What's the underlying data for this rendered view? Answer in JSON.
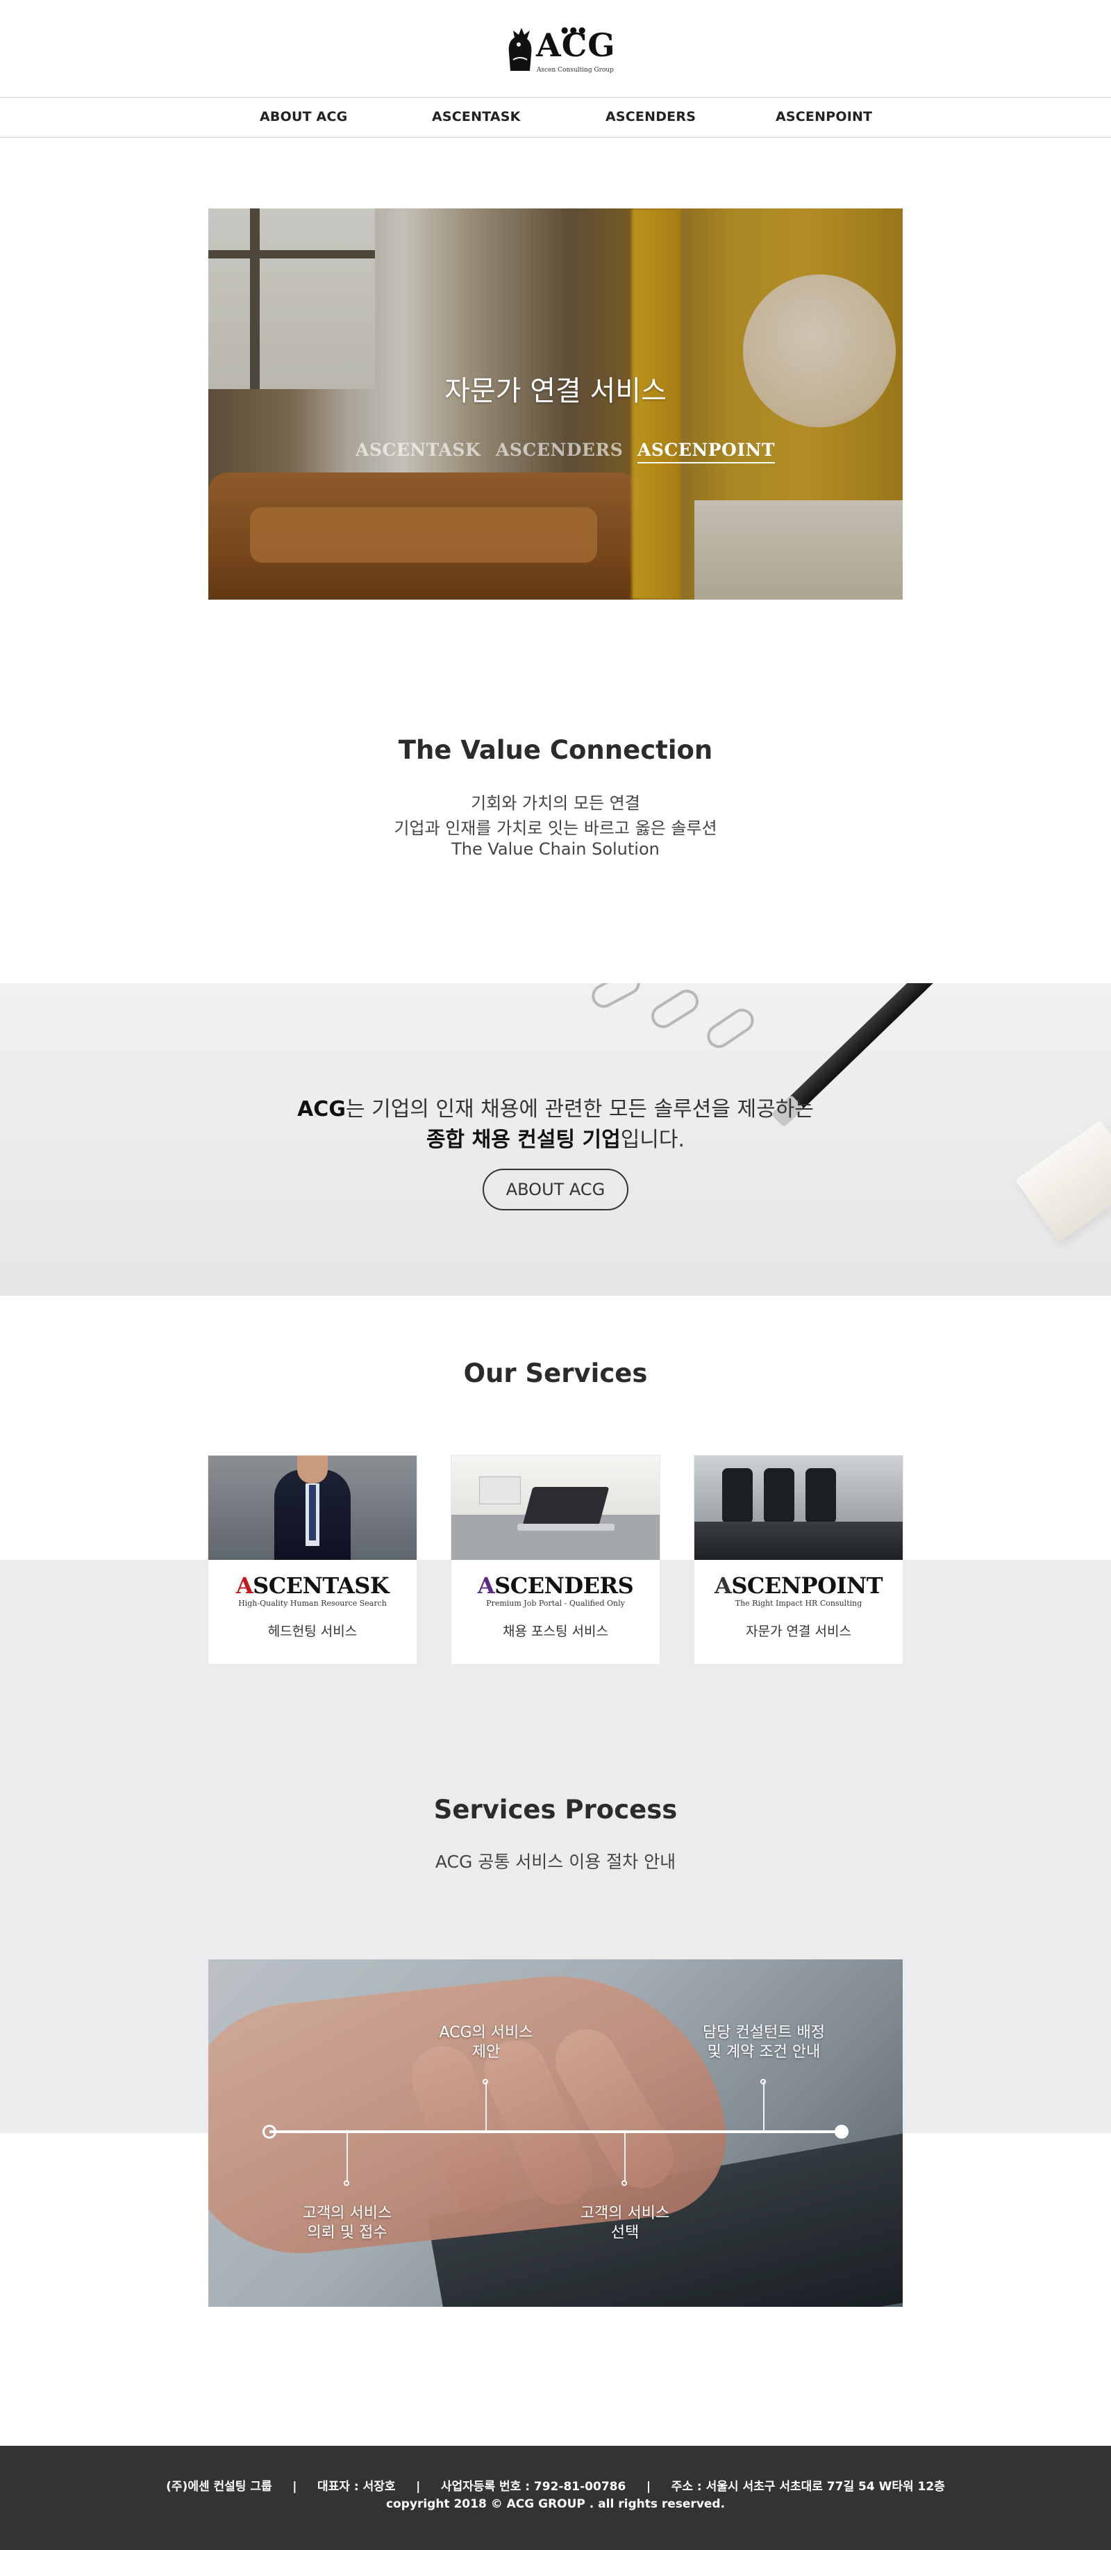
{
  "header": {
    "logo_text": "ACG",
    "logo_sub": "Ascen Consulting Group"
  },
  "nav": {
    "items": [
      "ABOUT ACG",
      "ASCENTASK",
      "ASCENDERS",
      "ASCENPOINT"
    ]
  },
  "hero": {
    "title": "자문가 연결 서비스",
    "tabs": [
      "ASCENTASK",
      "ASCENDERS",
      "ASCENPOINT"
    ],
    "active_tab": "ASCENPOINT"
  },
  "value": {
    "title": "The Value Connection",
    "lines": [
      "기회와 가치의 모든 연결",
      "기업과 인재를 가치로 잇는 바르고 옳은 솔루션",
      "The Value Chain Solution"
    ]
  },
  "banner": {
    "line1_bold": "ACG",
    "line1_rest": "는 기업의 인재 채용에 관련한 모든 솔루션을 제공하는",
    "line2_bold": "종합 채용 컨설팅 기업",
    "line2_rest": "입니다.",
    "button_label": "ABOUT ACG"
  },
  "services": {
    "title": "Our Services",
    "cards": [
      {
        "logo_first": "A",
        "logo_rest": "SCENTASK",
        "tagline": "High-Quality Human Resource Search",
        "label": "헤드헌팅 서비스",
        "accent": "#c4161c"
      },
      {
        "logo_first": "A",
        "logo_rest": "SCENDERS",
        "tagline": "Premium Job Portal - Qualified Only",
        "label": "채용 포스팅 서비스",
        "accent": "#5b2a86"
      },
      {
        "logo_first": "A",
        "logo_rest": "SCENPOINT",
        "tagline": "The Right Impact HR Consulting",
        "label": "자문가 연결 서비스",
        "accent": "#333333"
      }
    ]
  },
  "process": {
    "title": "Services Process",
    "subtitle": "ACG 공통 서비스 이용 절차 안내",
    "steps": [
      {
        "line1": "고객의 서비스",
        "line2": "의뢰 및 접수"
      },
      {
        "line1": "ACG의 서비스",
        "line2": "제안"
      },
      {
        "line1": "고객의 서비스",
        "line2": "선택"
      },
      {
        "line1": "담당 컨설턴트 배정",
        "line2": "및 계약 조건 안내"
      }
    ]
  },
  "footer": {
    "line1": "(주)에센 컨설팅 그룹     |     대표자 : 서장호     |     사업자등록 번호 : 792-81-00786     |     주소 : 서울시 서초구 서초대로 77길 54 W타워 12층",
    "line2": "copyright 2018 © ACG GROUP . all rights reserved."
  },
  "colors": {
    "footer_bg": "#333333",
    "band_gray": "#ececee",
    "text_dark": "#2b2b2b"
  }
}
